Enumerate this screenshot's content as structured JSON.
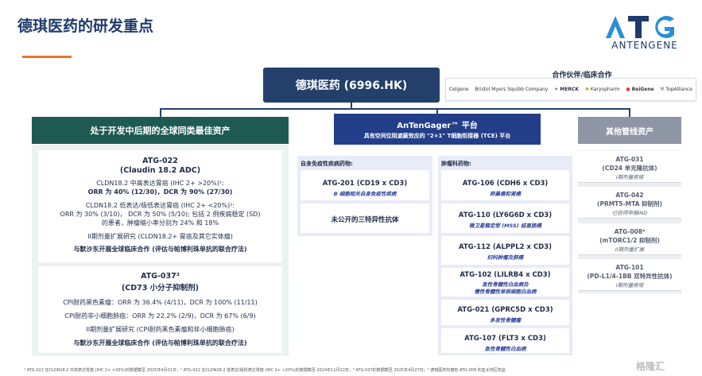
{
  "page": {
    "title": "德琪医药的研发重点"
  },
  "logo": {
    "letters": "ATG",
    "name": "ANTENGENE",
    "accent": "#2a8fd6"
  },
  "main_box": {
    "label": "德琪医药 (6996.HK)"
  },
  "partners": {
    "title": "合作伙伴/临床合作",
    "items": [
      "Celgene",
      "Bristol Myers Squibb Company",
      "MERCK",
      "Karyopharm",
      "BeiGene",
      "TopAlliance"
    ]
  },
  "col1": {
    "header": "处于开发中后期的全球同类最佳资产",
    "card1": {
      "title": "ATG-022",
      "subtitle": "(Claudin 18.2 ADC)",
      "l1": "CLDN18.2 中高表达胃癌 (IHC 2+ >20%)¹:",
      "l2": "ORR 为 40% (12/30)，DCR 为 90% (27/30)",
      "l3": "CLDN18.2 低表达/极低表达胃癌 (IHC 2+ <20%)²:",
      "l4": "ORR 为 30% (3/10)， DCR 为 50% (5/10); 包括 2 例疾病稳定 (SD)",
      "l5": "的患者，肿瘤缩小率分别为 24% 和 18%",
      "l6": "II期剂量扩展研究 (CLDN18.2+ 胃癌及其它实体瘤)",
      "l7": "与默沙东开展全球临床合作 (评估与帕博利珠单抗的联合疗法)"
    },
    "card2": {
      "title": "ATG-037³",
      "subtitle": "(CD73 小分子抑制剂)",
      "l1": "CPI耐药黑色素瘤：ORR 为 36.4% (4/11)，DCR 为 100% (11/11)",
      "l2": "CPI耐药非小细胞肺癌：ORR 为 22.2% (2/9)，DCR 为 67% (6/9)",
      "l3": "II期剂量扩展研究 (CPI耐药黑色素瘤和非小细胞肺癌)",
      "l4": "与默沙东开展全球临床合作 (评估与帕博利珠单抗的联合疗法)"
    }
  },
  "col2": {
    "header": "AnTenGager™ 平台",
    "header_sub": "具有空间位阻遮蔽效应的 \"2+1\" T细胞衔接器 (TCE) 平台",
    "group_a_label": "自身免疫性疾病药物:",
    "group_b_label": "肿瘤科药物:",
    "autoimmune": [
      {
        "name": "ATG-201 (CD19 x CD3)",
        "desc": "B 细胞相关自身免疫性疾病"
      },
      {
        "name": "未公开的三特异性抗体",
        "desc": ""
      }
    ],
    "oncology": [
      {
        "name": "ATG-106 (CDH6 x CD3)",
        "desc": "卵巢癌和肾癌"
      },
      {
        "name": "ATG-110 (LY6G6D x CD3)",
        "desc": "微卫星稳定型 (MSS) 结直肠癌"
      },
      {
        "name": "ATG-112 (ALPPL2 x CD3)",
        "desc": "妇科肿瘤及肺癌"
      },
      {
        "name": "ATG-102 (LILRB4 x CD3)",
        "desc": "急性骨髓性白血病及",
        "desc2": "慢性骨髓性单核细胞白血病"
      },
      {
        "name": "ATG-021 (GPRC5D x CD3)",
        "desc": "多发性骨髓瘤"
      },
      {
        "name": "ATG-107 (FLT3 x CD3)",
        "desc": "急性骨髓性白血病"
      }
    ]
  },
  "col3": {
    "header": "其他管线资产",
    "items": [
      {
        "name": "ATG-031",
        "sub": "(CD24 单克隆抗体)",
        "stage": "I期剂量爬坡"
      },
      {
        "name": "ATG-042",
        "sub": "(PRMT5-MTA 抑制剂)",
        "stage": "已获得申报IND"
      },
      {
        "name": "ATG-008⁴",
        "sub": "(mTORC1/2 抑制剂)",
        "stage": "II期剂量扩展"
      },
      {
        "name": "ATG-101",
        "sub": "(PD-L1/4-1BB 双特异性抗体)",
        "stage": "I期剂量爬坡"
      }
    ]
  },
  "footer": {
    "text": "¹ ATG-022 在CLDN18.2 中高表达胃癌 (IHC 2+ >20%)的数据截至 2025年4月21日；² ATG-022 在CLDN18.2 低表达/极低表达胃癌 (IHC 2+ <20%)的数据截至 2024年11月22日；³ ATG-037的数据截至 2025年4月27日；⁴ 德琪医药仅拥有 ATG-008 的亚太地区权益"
  },
  "watermark": {
    "text": "格隆汇"
  }
}
